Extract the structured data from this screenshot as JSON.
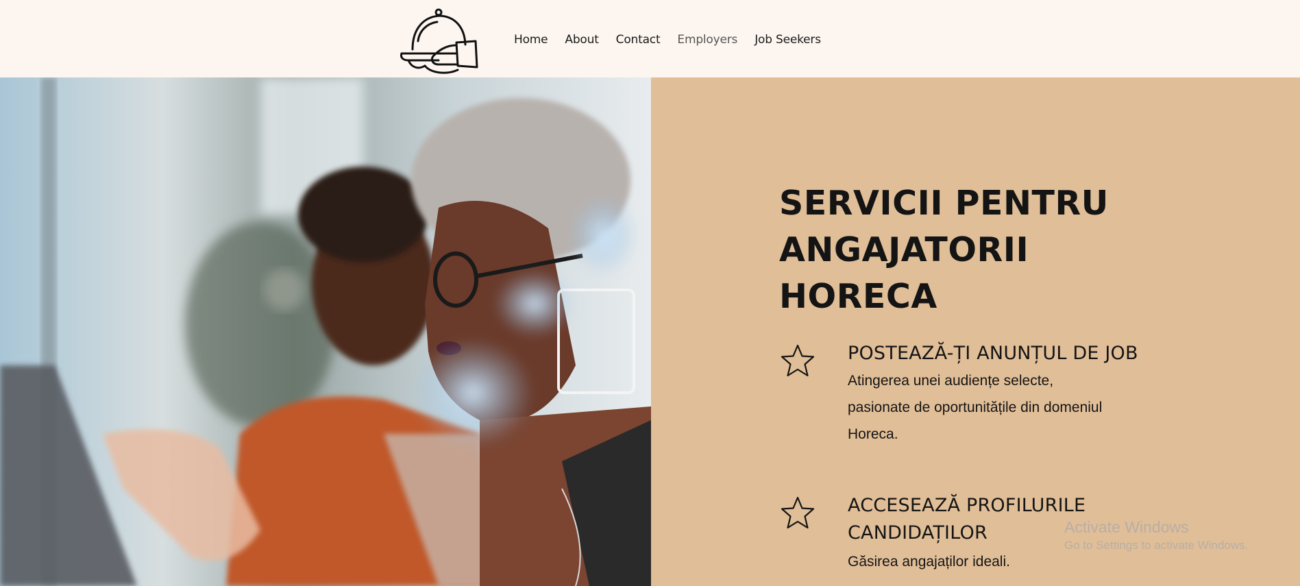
{
  "header": {
    "logo_icon": "cloche-serving-hand-icon",
    "nav": [
      {
        "label": "Home"
      },
      {
        "label": "About"
      },
      {
        "label": "Contact"
      },
      {
        "label": "Employers"
      },
      {
        "label": "Job Seekers"
      }
    ],
    "active_nav": "Employers"
  },
  "hero": {
    "photo_description_icon": "photo-two-women-at-laptop",
    "title_lines": [
      "SERVICII PENTRU",
      "ANGAJATORII",
      "HORECA"
    ],
    "features": [
      {
        "icon": "star-outline-icon",
        "title_lines": [
          "POSTEAZĂ-ȚI ANUNȚUL DE JOB"
        ],
        "body_lines": [
          "Atingerea unei audiențe selecte,",
          "pasionate de oportunitățile din domeniul",
          "Horeca."
        ]
      },
      {
        "icon": "star-outline-icon",
        "title_lines": [
          "ACCESEAZĂ PROFILURILE",
          "CANDIDAȚILOR"
        ],
        "body_lines": [
          "Găsirea angajaților ideali."
        ]
      }
    ]
  },
  "watermark": {
    "line1": "Activate Windows",
    "line2": "Go to Settings to activate Windows."
  },
  "colors": {
    "header_bg": "#fdf6f0",
    "panel_bg": "#e0be98",
    "text": "#141414"
  }
}
